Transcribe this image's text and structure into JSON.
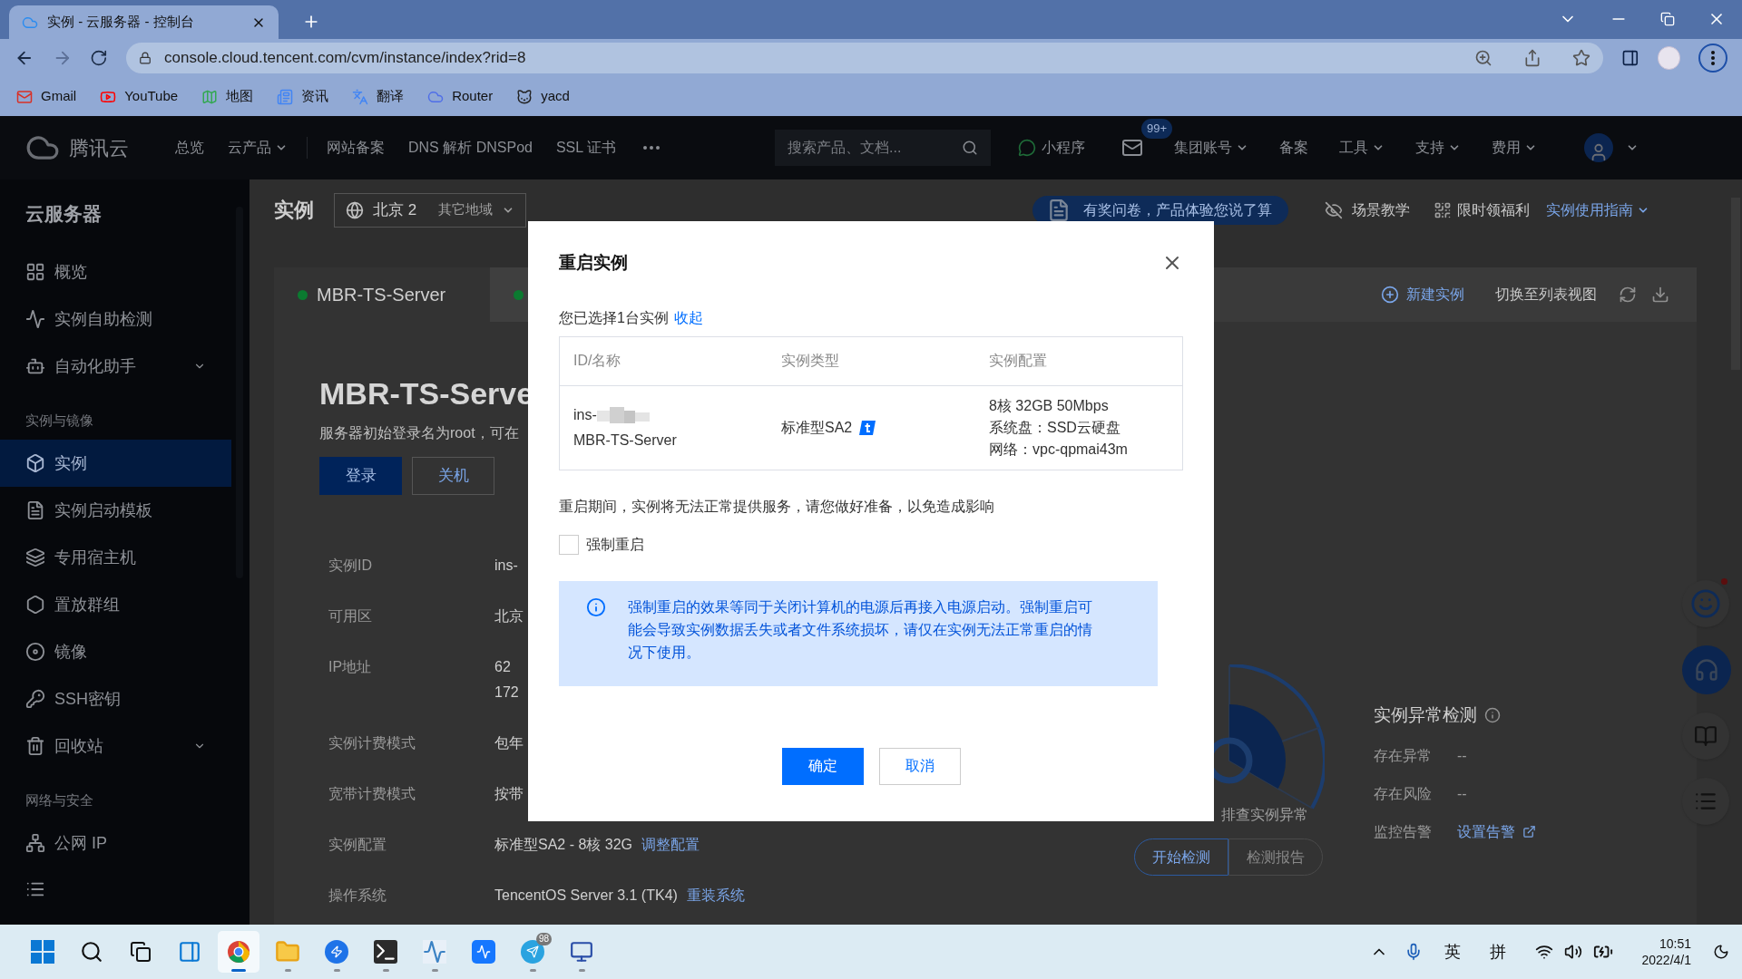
{
  "browser": {
    "tab_title": "实例 - 云服务器 - 控制台",
    "url": "console.cloud.tencent.com/cvm/instance/index?rid=8",
    "bookmarks": [
      "Gmail",
      "YouTube",
      "地图",
      "资讯",
      "翻译",
      "Router",
      "yacd"
    ]
  },
  "topnav": {
    "brand": "腾讯云",
    "items": [
      {
        "label": "总览",
        "dropdown": false
      },
      {
        "label": "云产品",
        "dropdown": true
      },
      {
        "label": "网站备案",
        "dropdown": false
      },
      {
        "label": "DNS 解析 DNSPod",
        "dropdown": false
      },
      {
        "label": "SSL 证书",
        "dropdown": false
      }
    ],
    "search_placeholder": "搜索产品、文档...",
    "mini_program": "小程序",
    "mail_badge": "99+",
    "right_items": [
      {
        "label": "集团账号",
        "dropdown": true
      },
      {
        "label": "备案",
        "dropdown": false
      },
      {
        "label": "工具",
        "dropdown": true
      },
      {
        "label": "支持",
        "dropdown": true
      },
      {
        "label": "费用",
        "dropdown": true
      }
    ]
  },
  "sidebar": {
    "title": "云服务器",
    "items": [
      {
        "kind": "item",
        "label": "概览",
        "selected": false,
        "expandable": false
      },
      {
        "kind": "item",
        "label": "实例自助检测",
        "selected": false,
        "expandable": false
      },
      {
        "kind": "item",
        "label": "自动化助手",
        "selected": false,
        "expandable": true
      },
      {
        "kind": "section",
        "label": "实例与镜像"
      },
      {
        "kind": "item",
        "label": "实例",
        "selected": true,
        "expandable": false
      },
      {
        "kind": "item",
        "label": "实例启动模板",
        "selected": false,
        "expandable": false
      },
      {
        "kind": "item",
        "label": "专用宿主机",
        "selected": false,
        "expandable": false
      },
      {
        "kind": "item",
        "label": "置放群组",
        "selected": false,
        "expandable": false
      },
      {
        "kind": "item",
        "label": "镜像",
        "selected": false,
        "expandable": false
      },
      {
        "kind": "item",
        "label": "SSH密钥",
        "selected": false,
        "expandable": false
      },
      {
        "kind": "item",
        "label": "回收站",
        "selected": false,
        "expandable": true
      },
      {
        "kind": "section",
        "label": "网络与安全"
      },
      {
        "kind": "item",
        "label": "公网 IP",
        "selected": false,
        "expandable": false
      }
    ]
  },
  "header": {
    "title": "实例",
    "region": "北京 2",
    "other_regions": "其它地域",
    "survey": "有奖问卷，产品体验您说了算",
    "tutorial": "场景教学",
    "benefits": "限时领福利",
    "guide": "实例使用指南"
  },
  "tabs": [
    {
      "label": "MBR-TS-Server",
      "selected": true
    },
    {
      "selected": false
    }
  ],
  "actions": {
    "new_instance": "新建实例",
    "list_view": "切换至列表视图"
  },
  "instance": {
    "name": "MBR-TS-Serve",
    "hint": "服务器初始登录名为root，可在",
    "buttons": [
      {
        "label": "登录",
        "kind": "primary"
      },
      {
        "label": "关机",
        "kind": "default"
      }
    ],
    "fields": [
      {
        "label": "实例ID",
        "values": [
          "ins-"
        ]
      },
      {
        "label": "可用区",
        "values": [
          "北京"
        ]
      },
      {
        "label": "IP地址",
        "values": [
          "62",
          "172"
        ]
      },
      {
        "label": "实例计费模式",
        "values": [
          "包年"
        ]
      },
      {
        "label": "宽带计费模式",
        "values": [
          "按带"
        ]
      },
      {
        "label": "实例配置",
        "values": [
          "标准型SA2 - 8核 32G"
        ],
        "link": "调整配置"
      },
      {
        "label": "操作系统",
        "values": [
          "TencentOS Server 3.1 (TK4)"
        ],
        "link": "重装系统"
      }
    ]
  },
  "inspection": {
    "gauge_caption": "排查实例异常",
    "buttons": [
      {
        "label": "开始检测",
        "disabled": false
      },
      {
        "label": "检测报告",
        "disabled": true
      }
    ],
    "title": "实例异常检测",
    "rows": [
      {
        "label": "存在异常",
        "value": "--"
      },
      {
        "label": "存在风险",
        "value": "--"
      },
      {
        "label": "监控告警",
        "link": "设置告警"
      }
    ]
  },
  "floating": {
    "feedback_unread": true
  },
  "modal": {
    "title": "重启实例",
    "selected_note": "您已选择1台实例",
    "collapse_link": "收起",
    "columns": [
      "ID/名称",
      "实例类型",
      "实例配置"
    ],
    "rows": [
      {
        "id": "ins-",
        "name": "MBR-TS-Server",
        "type": "标准型SA2",
        "config": [
          "8核 32GB 50Mbps",
          "系统盘：SSD云硬盘",
          "网络：vpc-qpmai43m"
        ]
      }
    ],
    "warning": "重启期间，实例将无法正常提供服务，请您做好准备，以免造成影响",
    "force": {
      "label": "强制重启",
      "checked": false
    },
    "alert": "强制重启的效果等同于关闭计算机的电源后再接入电源启动。强制重启可能会导致实例数据丢失或者文件系统损坏，请仅在实例无法正常重启的情况下使用。",
    "confirm": "确定",
    "cancel": "取消"
  },
  "taskbar": {
    "apps": [
      {
        "running": false,
        "selected": false
      },
      {
        "running": false,
        "selected": false
      },
      {
        "running": false,
        "selected": false
      },
      {
        "running": false,
        "selected": false
      },
      {
        "running": true,
        "selected": true
      },
      {
        "running": true,
        "selected": false
      },
      {
        "running": true,
        "selected": false
      },
      {
        "running": true,
        "selected": false
      },
      {
        "running": true,
        "selected": false
      },
      {
        "running": false,
        "selected": false
      },
      {
        "running": true,
        "selected": false,
        "badge": "98"
      },
      {
        "running": true,
        "selected": false
      }
    ],
    "ime": "英",
    "ime_mode": "拼",
    "time": "10:51",
    "date": "2022/4/1"
  }
}
